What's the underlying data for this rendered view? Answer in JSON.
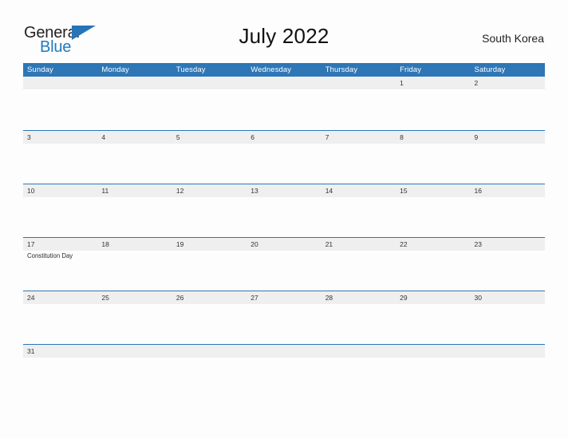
{
  "brand": {
    "word_one": "General",
    "word_two": "Blue",
    "flag_icon": "blue-triangle-flag-icon",
    "primary_color": "#2e76b6",
    "text_color": "#231f20"
  },
  "header": {
    "title": "July 2022",
    "region": "South Korea"
  },
  "calendar": {
    "month": "July",
    "year": "2022",
    "day_headers": [
      "Sunday",
      "Monday",
      "Tuesday",
      "Wednesday",
      "Thursday",
      "Friday",
      "Saturday"
    ],
    "header_bg_color": "#2e76b6",
    "date_band_color": "#efefef",
    "row_border_color": "#2e76b6",
    "weeks": [
      {
        "days": [
          {
            "date": "",
            "events": []
          },
          {
            "date": "",
            "events": []
          },
          {
            "date": "",
            "events": []
          },
          {
            "date": "",
            "events": []
          },
          {
            "date": "",
            "events": []
          },
          {
            "date": "1",
            "events": []
          },
          {
            "date": "2",
            "events": []
          }
        ]
      },
      {
        "days": [
          {
            "date": "3",
            "events": []
          },
          {
            "date": "4",
            "events": []
          },
          {
            "date": "5",
            "events": []
          },
          {
            "date": "6",
            "events": []
          },
          {
            "date": "7",
            "events": []
          },
          {
            "date": "8",
            "events": []
          },
          {
            "date": "9",
            "events": []
          }
        ]
      },
      {
        "days": [
          {
            "date": "10",
            "events": []
          },
          {
            "date": "11",
            "events": []
          },
          {
            "date": "12",
            "events": []
          },
          {
            "date": "13",
            "events": []
          },
          {
            "date": "14",
            "events": []
          },
          {
            "date": "15",
            "events": []
          },
          {
            "date": "16",
            "events": []
          }
        ]
      },
      {
        "days": [
          {
            "date": "17",
            "events": [
              "Constitution Day"
            ]
          },
          {
            "date": "18",
            "events": []
          },
          {
            "date": "19",
            "events": []
          },
          {
            "date": "20",
            "events": []
          },
          {
            "date": "21",
            "events": []
          },
          {
            "date": "22",
            "events": []
          },
          {
            "date": "23",
            "events": []
          }
        ]
      },
      {
        "days": [
          {
            "date": "24",
            "events": []
          },
          {
            "date": "25",
            "events": []
          },
          {
            "date": "26",
            "events": []
          },
          {
            "date": "27",
            "events": []
          },
          {
            "date": "28",
            "events": []
          },
          {
            "date": "29",
            "events": []
          },
          {
            "date": "30",
            "events": []
          }
        ]
      },
      {
        "days": [
          {
            "date": "31",
            "events": []
          },
          {
            "date": "",
            "events": []
          },
          {
            "date": "",
            "events": []
          },
          {
            "date": "",
            "events": []
          },
          {
            "date": "",
            "events": []
          },
          {
            "date": "",
            "events": []
          },
          {
            "date": "",
            "events": []
          }
        ]
      }
    ]
  }
}
